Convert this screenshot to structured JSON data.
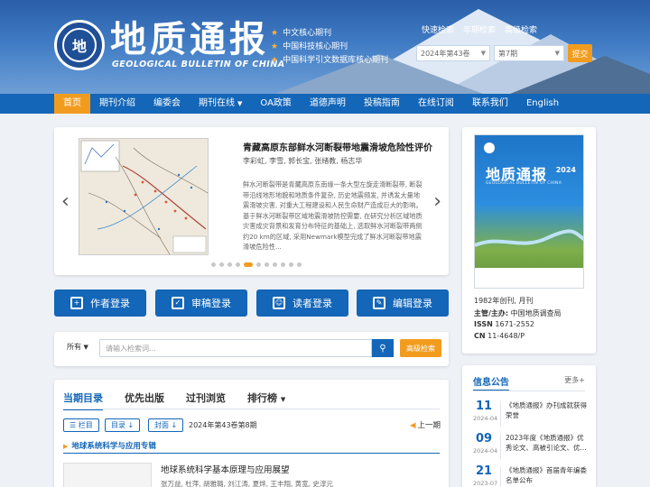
{
  "header": {
    "seal_char": "地",
    "title_cn": "地质通报",
    "title_en": "GEOLOGICAL BULLETIN OF CHINA",
    "indexes": [
      "中文核心期刊",
      "中国科技核心期刊",
      "中国科学引文数据库核心期刊"
    ]
  },
  "search_panel": {
    "tabs": [
      "快速检索",
      "年期检索",
      "高级检索"
    ],
    "year_value": "2024年第43卷",
    "issue_value": "第7期",
    "submit_label": "提交"
  },
  "nav": {
    "items": [
      "首页",
      "期刊介绍",
      "编委会",
      "期刊在线",
      "OA政策",
      "道德声明",
      "投稿指南",
      "在线订阅",
      "联系我们",
      "English"
    ]
  },
  "carousel": {
    "title": "青藏高原东部鲜水河断裂带地震滑坡危险性评价",
    "authors": "李彩虹, 李雪, 郭长宝, 张绪教, 杨志华",
    "abstract": "鲜水河断裂带是青藏高原东南缘一条大型左旋走滑断裂带, 断裂带沿线地形地貌和地质条件复杂, 历史地震频发, 并诱发大量地震滑坡灾害, 对重大工程建设和人民生命财产造成巨大的影响。基于鲜水河断裂带区域地震滑坡防控需要, 在研究分析区域地质灾害成灾背景和发育分布特征的基础上, 选取鲜水河断裂带两侧约20 km的区域, 采用Newmark模型完成了鲜水河断裂带地震滑坡危险性..."
  },
  "login_buttons": [
    "作者登录",
    "审稿登录",
    "读者登录",
    "编辑登录"
  ],
  "quick_search": {
    "scope": "所有",
    "placeholder": "请输入检索词...",
    "advanced_label": "高级检索"
  },
  "issue": {
    "tabs": [
      "当期目录",
      "优先出版",
      "过刊浏览",
      "排行榜"
    ],
    "filters": [
      "栏目",
      "目录",
      "封面"
    ],
    "issue_info": "2024年第43卷第8期",
    "prev_label": "上一期",
    "section": "地球系统科学与应用专辑",
    "article_title": "地球系统科学基本原理与应用展望",
    "article_authors": "张万益, 杜萍, 胡雅璐, 刘江涛, 夏烨, 王丰翔, 黄宽, 史淳元"
  },
  "journal": {
    "cover_title": "地质通报",
    "cover_year": "2024",
    "cover_en": "GEOLOGICAL BULLETIN OF CHINA",
    "founded": "1982年创刊, 月刊",
    "sponsor_label": "主管/主办:",
    "sponsor": "中国地质调查局",
    "issn_label": "ISSN",
    "issn": "1671-2552",
    "cn_label": "CN",
    "cn": "11-4648/P"
  },
  "notice": {
    "title": "信息公告",
    "more": "更多+",
    "items": [
      {
        "day": "11",
        "ym": "2024-04",
        "text": "《地质通报》办刊成就获得荣誉"
      },
      {
        "day": "09",
        "ym": "2024-04",
        "text": "2023年度《地质通报》优秀论文、高被引论文、优..."
      },
      {
        "day": "21",
        "ym": "2023-07",
        "text": "《地质通报》首届青年编委名单公布"
      }
    ]
  },
  "colors": {
    "primary": "#1366b8",
    "accent": "#f29c1f"
  }
}
